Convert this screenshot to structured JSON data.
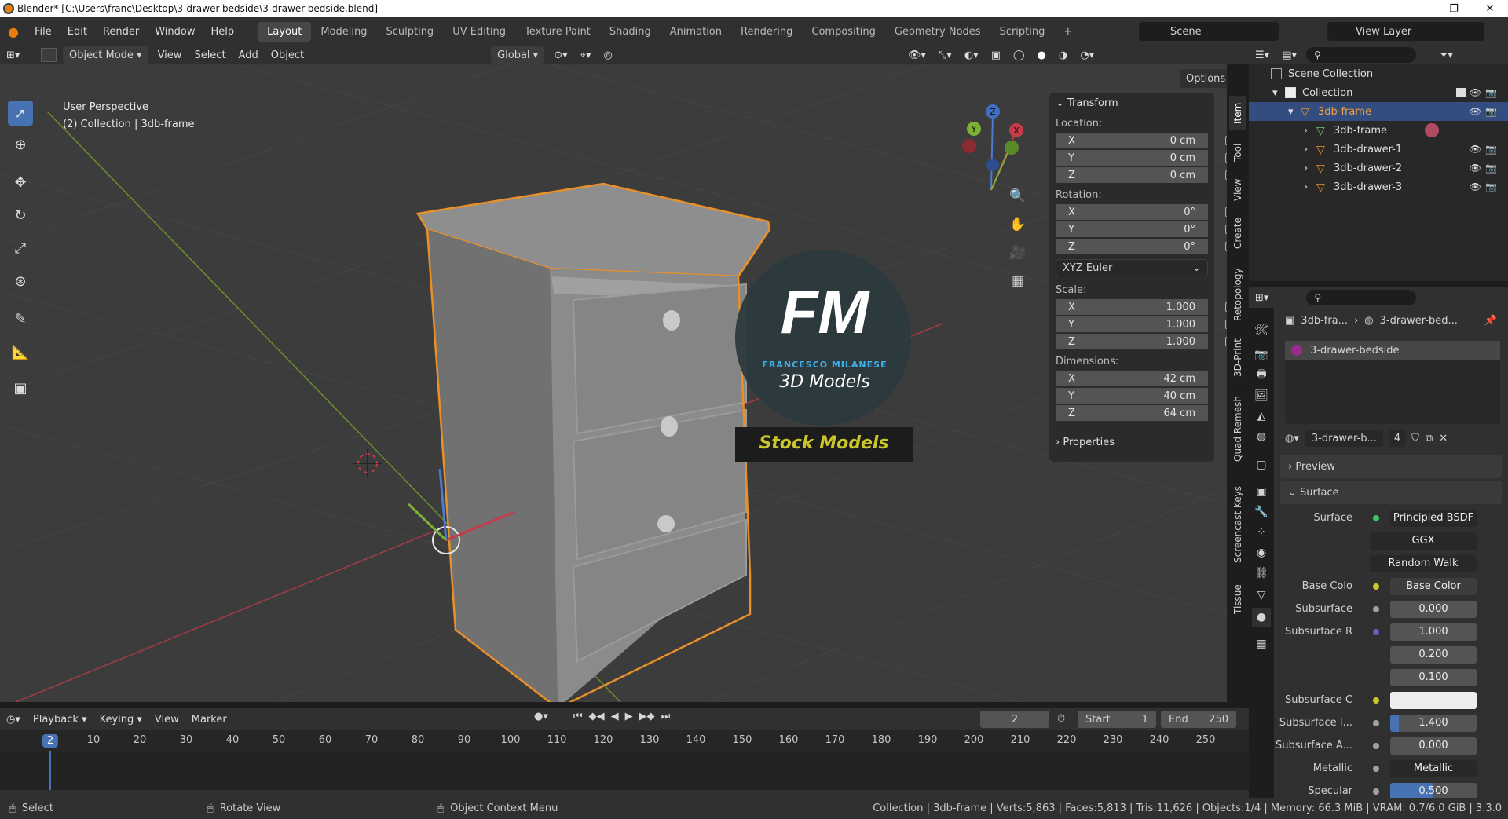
{
  "title_bar": {
    "title": "Blender* [C:\\Users\\franc\\Desktop\\3-drawer-bedside\\3-drawer-bedside.blend]",
    "minimize": "—",
    "maximize": "❐",
    "close": "✕"
  },
  "menu": [
    "File",
    "Edit",
    "Render",
    "Window",
    "Help"
  ],
  "workspaces": [
    "Layout",
    "Modeling",
    "Sculpting",
    "UV Editing",
    "Texture Paint",
    "Shading",
    "Animation",
    "Rendering",
    "Compositing",
    "Geometry Nodes",
    "Scripting"
  ],
  "workspace_add": "+",
  "active_workspace": "Layout",
  "scene": {
    "label": "Scene",
    "view_layer": "View Layer"
  },
  "viewport_header": {
    "mode": "Object Mode",
    "menus": [
      "View",
      "Select",
      "Add",
      "Object"
    ],
    "orientation": "Global",
    "options": "Options"
  },
  "viewport_info": {
    "line1": "User Perspective",
    "line2": "(2) Collection | 3db-frame"
  },
  "gizmo": {
    "x": "X",
    "y": "Y",
    "z": "Z"
  },
  "watermark": {
    "monogram": "FM",
    "brand": "FRANCESCO MILANESE",
    "sub": "3D Models",
    "banner": "Stock Models"
  },
  "npanel": {
    "transform_title": "Transform",
    "location_label": "Location:",
    "location": [
      {
        "axis": "X",
        "value": "0 cm"
      },
      {
        "axis": "Y",
        "value": "0 cm"
      },
      {
        "axis": "Z",
        "value": "0 cm"
      }
    ],
    "rotation_label": "Rotation:",
    "rotation": [
      {
        "axis": "X",
        "value": "0°"
      },
      {
        "axis": "Y",
        "value": "0°"
      },
      {
        "axis": "Z",
        "value": "0°"
      }
    ],
    "rotation_mode": "XYZ Euler",
    "scale_label": "Scale:",
    "scale": [
      {
        "axis": "X",
        "value": "1.000"
      },
      {
        "axis": "Y",
        "value": "1.000"
      },
      {
        "axis": "Z",
        "value": "1.000"
      }
    ],
    "dimensions_label": "Dimensions:",
    "dimensions": [
      {
        "axis": "X",
        "value": "42 cm"
      },
      {
        "axis": "Y",
        "value": "40 cm"
      },
      {
        "axis": "Z",
        "value": "64 cm"
      }
    ],
    "properties_title": "Properties"
  },
  "sidebar_tabs": [
    "Item",
    "Tool",
    "View",
    "Create",
    "Retopology",
    "3D-Print",
    "Quad Remesh",
    "Screencast Keys",
    "Tissue"
  ],
  "outliner": {
    "scene_collection": "Scene Collection",
    "collection": "Collection",
    "items": [
      {
        "name": "3db-frame",
        "selected": true
      },
      {
        "name": "3db-frame",
        "selected": false
      },
      {
        "name": "3db-drawer-1",
        "selected": false
      },
      {
        "name": "3db-drawer-2",
        "selected": false
      },
      {
        "name": "3db-drawer-3",
        "selected": false
      }
    ]
  },
  "properties": {
    "breadcrumb_obj": "3db-fra...",
    "breadcrumb_mat": "3-drawer-bed...",
    "material_slot": "3-drawer-bedside",
    "material_name": "3-drawer-b...",
    "users": "4",
    "preview": "Preview",
    "surface_section": "Surface",
    "surface_label": "Surface",
    "surface_value": "Principled BSDF",
    "distribution": "GGX",
    "subsurface_method": "Random Walk",
    "rows": [
      {
        "label": "Base Colo",
        "value": "Base Color"
      },
      {
        "label": "Subsurface",
        "value": "0.000"
      },
      {
        "label": "Subsurface R",
        "value": "1.000"
      },
      {
        "label": "",
        "value": "0.200"
      },
      {
        "label": "",
        "value": "0.100"
      },
      {
        "label": "Subsurface C",
        "value": ""
      },
      {
        "label": "Subsurface I...",
        "value": "1.400"
      },
      {
        "label": "Subsurface A...",
        "value": "0.000"
      },
      {
        "label": "Metallic",
        "value": "Metallic"
      },
      {
        "label": "Specular",
        "value": "0.500"
      }
    ]
  },
  "timeline": {
    "menus": [
      "Playback",
      "Keying",
      "View",
      "Marker"
    ],
    "current_frame": "2",
    "start_label": "Start",
    "start": "1",
    "end_label": "End",
    "end": "250",
    "ticks": [
      "2",
      "10",
      "20",
      "30",
      "40",
      "50",
      "60",
      "70",
      "80",
      "90",
      "100",
      "110",
      "120",
      "130",
      "140",
      "150",
      "160",
      "170",
      "180",
      "190",
      "200",
      "210",
      "220",
      "230",
      "240",
      "250"
    ]
  },
  "status": {
    "select": "Select",
    "rotate": "Rotate View",
    "context": "Object Context Menu",
    "stats": "Collection | 3db-frame | Verts:5,863 | Faces:5,813 | Tris:11,626 | Objects:1/4 | Memory: 66.3 MiB | VRAM: 0.7/6.0 GiB | 3.3.0"
  },
  "colors": {
    "accent": "#4772b3",
    "selection": "#e8902a",
    "viewport": "#3c3c3c",
    "header": "#303030"
  }
}
